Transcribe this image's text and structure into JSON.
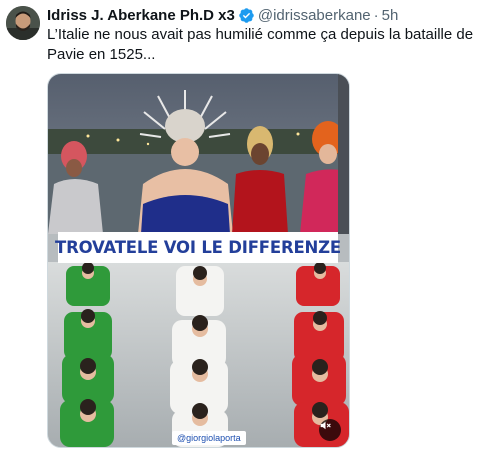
{
  "tweet": {
    "author_name": "Idriss J. Aberkane Ph.D x3",
    "handle": "@idrissaberkane",
    "separator": "·",
    "time": "5h",
    "text": "L’Italie ne nous avait pas humilié comme ça depuis la bataille de Pavie en 1525..."
  },
  "media": {
    "banner_text": "TROVATELE VOI LE DIFFERENZE",
    "credit": "@giorgiolaporta",
    "mute_icon": "speaker-muted-icon"
  },
  "colors": {
    "verified": "#1d9bf0",
    "banner_text": "#233f9a",
    "green": "#2f9a3a",
    "red": "#d6262b",
    "white_suit": "#f4f4f2"
  }
}
